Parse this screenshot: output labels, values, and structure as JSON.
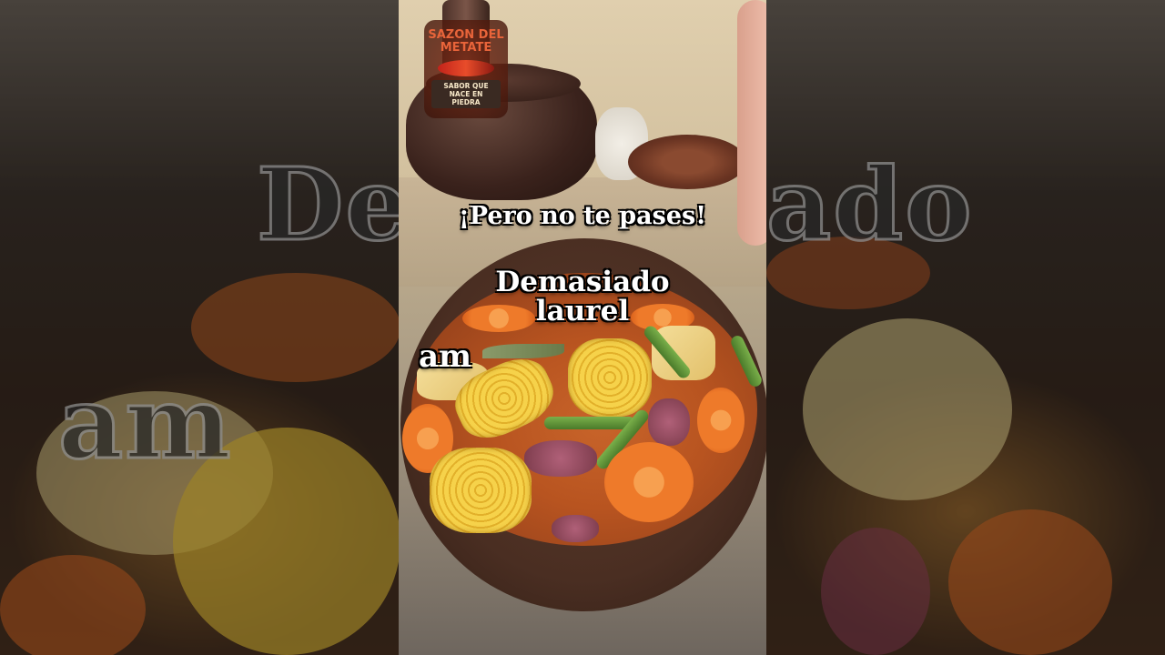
{
  "video": {
    "caption_main": "¡Pero no te pases!",
    "caption_note_line1": "Demasiado",
    "caption_note_line2": "laurel",
    "caption_partial": "am"
  },
  "brand_logo": {
    "name": "SAZON DEL METATE",
    "tagline": "SABOR QUE NACE EN PIEDRA"
  },
  "background_text": {
    "left_top": "De",
    "right_top": "ado",
    "left_bottom": "am"
  },
  "colors": {
    "caption_text": "#ffffff",
    "caption_outline": "#000000",
    "broth": "#c8642a",
    "corn": "#f6d24a",
    "carrot": "#ee7a2a"
  }
}
